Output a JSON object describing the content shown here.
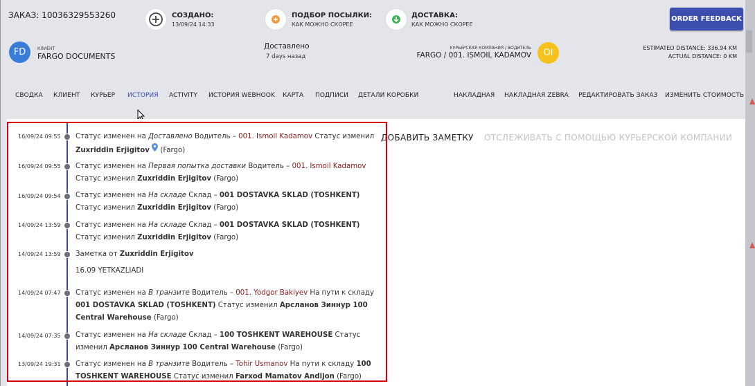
{
  "header": {
    "order_label": "ЗАКАЗ: 10036329553260",
    "created": {
      "title": "СОЗДАНО:",
      "value": "13/09/24 14:33"
    },
    "pickup": {
      "title": "ПОДБОР ПОСЫЛКИ:",
      "value": "КАК МОЖНО СКОРЕЕ"
    },
    "delivery": {
      "title": "ДОСТАВКА:",
      "value": "КАК МОЖНО СКОРЕЕ"
    },
    "feedback_button": "ORDER FEEDBACK"
  },
  "client": {
    "initials": "FD",
    "label": "КЛИЕНТ",
    "name": "FARGO DOCUMENTS"
  },
  "status": {
    "title": "Доставлено",
    "ago": "7 days назад"
  },
  "courier": {
    "label": "КУРЬЕРСКАЯ КОМПАНИЯ / ВОДИТЕЛЬ",
    "name": "FARGO / 001. ISMOIL KADAMOV",
    "initials": "OI"
  },
  "distance": {
    "estimated": "ESTIMATED DISTANCE: 336.94 KM",
    "actual": "ACTUAL DISTANCE: 0 KM"
  },
  "tabs": [
    {
      "label": "СВОДКА"
    },
    {
      "label": "КЛИЕНТ"
    },
    {
      "label": "КУРЬЕР"
    },
    {
      "label": "ИСТОРИЯ"
    },
    {
      "label": "ACTIVITY"
    },
    {
      "label": "ИСТОРИЯ WEBHOOK"
    },
    {
      "label": "КАРТА"
    },
    {
      "label": "ПОДПИСИ"
    },
    {
      "label": "ДЕТАЛИ КОРОБКИ"
    }
  ],
  "actions": [
    {
      "label": "НАКЛАДНАЯ"
    },
    {
      "label": "НАКЛАДНАЯ ZEBRA"
    },
    {
      "label": "РЕДАКТИРОВАТЬ ЗАКАЗ"
    },
    {
      "label": "ИЗМЕНИТЬ СТОИМОСТЬ"
    }
  ],
  "buttons": {
    "add_note": "ДОБАВИТЬ ЗАМЕТКУ",
    "track": "ОТСЛЕЖИВАТЬ С ПОМОЩЬЮ КУРЬЕРСКОЙ КОМПАНИИ"
  },
  "history": [
    {
      "date": "16/09/24 09:55",
      "p1": "Статус изменен на ",
      "status": "Доставлено",
      "p2": " Водитель – ",
      "driver": "001. Ismoil Kadamov",
      "p3": " Статус изменил ",
      "who": "Zuxriddin Erjigitov",
      "p4": " (Fargo)"
    },
    {
      "date": "16/09/24 09:55",
      "p1": "Статус изменен на ",
      "status": "Первая попытка доставки",
      "p2": " Водитель – ",
      "driver": "001. Ismoil Kadamov",
      "p3": " Статус изменил ",
      "who": "Zuxriddin Erjigitov",
      "p4": " (Fargo)"
    },
    {
      "date": "16/09/24 09:54",
      "p1": "Статус изменен на ",
      "status": "На складе",
      "p2": " Склад – ",
      "driver": "001 DOSTAVKA SKLAD (TOSHKENT)",
      "p3": " Статус изменил ",
      "who": "Zuxriddin Erjigitov",
      "p4": " (Fargo)"
    },
    {
      "date": "14/09/24 13:59",
      "p1": "Статус изменен на ",
      "status": "На складе",
      "p2": " Склад – ",
      "driver": "001 DOSTAVKA SKLAD (TOSHKENT)",
      "p3": " Статус изменил ",
      "who": "Zuxriddin Erjigitov",
      "p4": " (Fargo)"
    },
    {
      "date": "14/09/24 13:59",
      "p1": "Заметка от ",
      "who": "Zuxriddin Erjigitov",
      "note": "16.09 YETKAZLIADI"
    },
    {
      "date": "14/09/24 07:47",
      "p1": "Статус изменен на ",
      "status": "В транзите",
      "p2": " Водитель – ",
      "driver": "001. Yodgor Bakiyev",
      "p3": " На пути к складу ",
      "dest": "001 DOSTAVKA SKLAD (TOSHKENT)",
      "p4": " Статус изменил ",
      "who": "Арсланов Зиннур 100 Central Warehouse",
      "p5": " (Fargo)"
    },
    {
      "date": "14/09/24 07:35",
      "p1": "Статус изменен на ",
      "status": "На складе",
      "p2": " Склад – ",
      "driver": "100 TOSHKENT WAREHOUSE",
      "p3": " Статус изменил ",
      "who": "Арсланов Зиннур 100 Central Warehouse",
      "p4": " (Fargo)"
    },
    {
      "date": "13/09/24 19:31",
      "p1": "Статус изменен на ",
      "status": "В транзите",
      "p2": " Водитель – ",
      "driver": "Tohir Usmanov",
      "p3": " На пути к складу ",
      "dest": "100 TOSHKENT WAREHOUSE",
      "p4": " Статус изменил ",
      "who": "Farxod Mamatov Andijon",
      "p5": " (Fargo)"
    }
  ],
  "colors": {
    "accent": "#3c4fae",
    "highlight_border": "#d6000d",
    "driver_link": "#8b1a1a",
    "courier_avatar": "#f6c11b",
    "client_avatar": "#3a7dd8"
  }
}
